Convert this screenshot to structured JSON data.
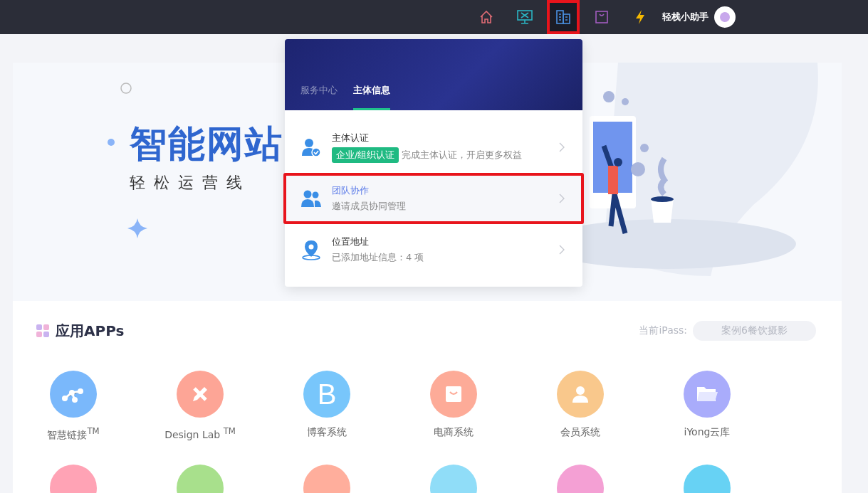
{
  "topbar": {
    "nav_icons": [
      {
        "kind": "home",
        "selected": false,
        "outlined": false
      },
      {
        "kind": "monitor",
        "selected": false,
        "outlined": false
      },
      {
        "kind": "building",
        "selected": true,
        "outlined": true
      },
      {
        "kind": "bag",
        "selected": false,
        "outlined": false
      },
      {
        "kind": "bolt",
        "selected": false,
        "outlined": false
      }
    ],
    "username": "轻栈小助手"
  },
  "banner": {
    "title": "智能网站",
    "subtitle": "轻松运营线"
  },
  "dropdown": {
    "tabs": [
      {
        "label": "服务中心",
        "selected": false
      },
      {
        "label": "主体信息",
        "selected": true
      }
    ],
    "items": [
      {
        "kind": "verify",
        "title": "主体认证",
        "badge": "企业/组织认证",
        "subtitle": "完成主体认证，开启更多权益",
        "hovered": false,
        "outlined": false
      },
      {
        "kind": "team",
        "title": "团队协作",
        "subtitle": "邀请成员协同管理",
        "hovered": true,
        "outlined": true
      },
      {
        "kind": "location",
        "title": "位置地址",
        "subtitle": "已添加地址信息：4 项",
        "hovered": false,
        "outlined": false
      }
    ]
  },
  "apps": {
    "title": "应用APPs",
    "ipass_label": "当前iPass:",
    "ipass_value": "案例6餐饮摄影",
    "items": [
      {
        "kind": "link",
        "label": "智慧链接$^{TM}$",
        "color": "#7ab8fb"
      },
      {
        "kind": "pencil",
        "label": "Design Lab $^{TM}$",
        "color": "#fda596"
      },
      {
        "kind": "letter",
        "glyph": "B",
        "label": "博客系统",
        "color": "#78c6fb"
      },
      {
        "kind": "bag",
        "label": "电商系统",
        "color": "#fdab98"
      },
      {
        "kind": "person",
        "label": "会员系统",
        "color": "#f9c88c"
      },
      {
        "kind": "folder",
        "label": "iYong云库",
        "color": "#a9acfb"
      }
    ],
    "more_items": [
      {
        "color": "#ffa3b5"
      },
      {
        "color": "#a8e08c"
      },
      {
        "color": "#ffae9c"
      },
      {
        "color": "#90ddf8"
      },
      {
        "color": "#f4a0d4"
      },
      {
        "color": "#67d2f4"
      }
    ]
  }
}
